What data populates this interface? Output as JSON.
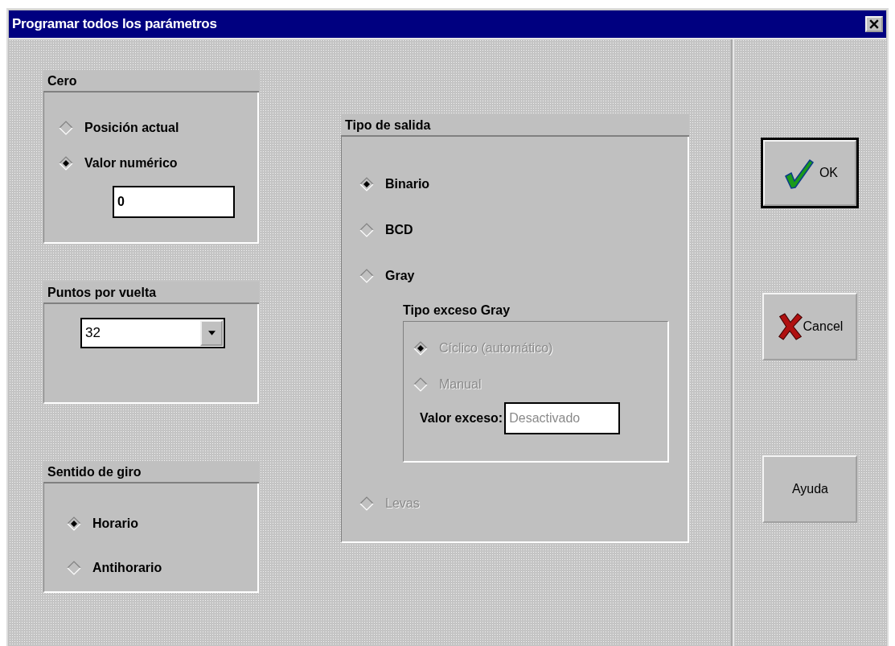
{
  "window": {
    "title": "Programar todos los parámetros"
  },
  "cero": {
    "title": "Cero",
    "options": [
      {
        "label": "Posición actual",
        "selected": false,
        "disabled": false
      },
      {
        "label": "Valor numérico",
        "selected": true,
        "disabled": false
      }
    ],
    "field": {
      "value": "0"
    }
  },
  "puntos_por_vuelta": {
    "title": "Puntos por vuelta",
    "combo": {
      "value": "32"
    }
  },
  "sentido_de_giro": {
    "title": "Sentido de giro",
    "options": [
      {
        "label": "Horario",
        "selected": true,
        "disabled": false
      },
      {
        "label": "Antihorario",
        "selected": false,
        "disabled": false
      }
    ]
  },
  "tipo_de_salida": {
    "title": "Tipo de salida",
    "items": [
      {
        "kind": "option",
        "label": "Binario",
        "selected": true,
        "disabled": false
      },
      {
        "kind": "option",
        "label": "BCD",
        "selected": false,
        "disabled": false
      },
      {
        "kind": "option",
        "label": "Gray",
        "selected": false,
        "disabled": false
      },
      {
        "kind": "subgroup",
        "title": "Tipo exceso Gray",
        "options": [
          {
            "label": "Cíclico (automático)",
            "selected": true,
            "disabled": true
          },
          {
            "label": "Manual",
            "selected": false,
            "disabled": true
          }
        ],
        "field": {
          "label": "Valor exceso:",
          "value": "Desactivado",
          "disabled": true
        }
      },
      {
        "kind": "option",
        "label": "Levas",
        "selected": false,
        "disabled": true
      }
    ]
  },
  "buttons": [
    {
      "kind": "ok",
      "label": "OK",
      "default": true
    },
    {
      "kind": "cancel",
      "label": "Cancel",
      "default": false
    },
    {
      "kind": "help",
      "label": "Ayuda",
      "default": false
    }
  ]
}
